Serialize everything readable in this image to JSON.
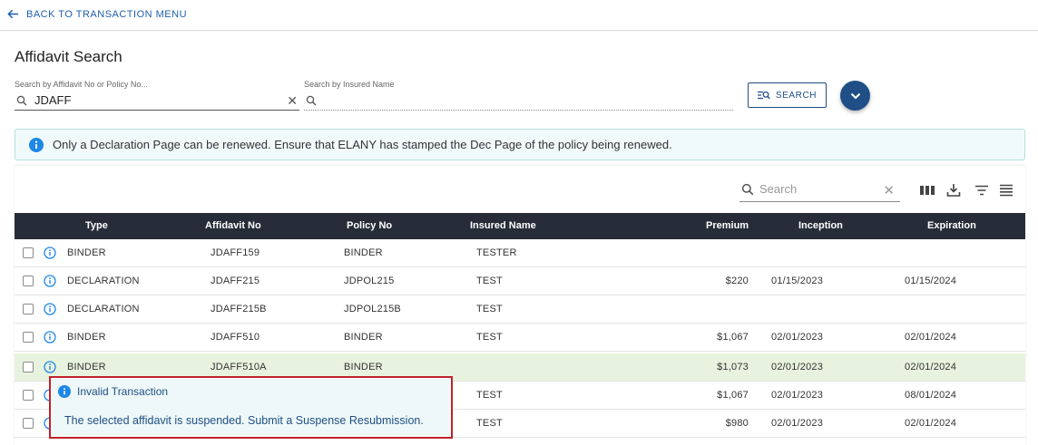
{
  "nav": {
    "back_label": "BACK TO TRANSACTION MENU"
  },
  "page": {
    "title": "Affidavit Search"
  },
  "search": {
    "affidavit_label": "Search by Affidavit No or Policy No...",
    "affidavit_value": "JDAFF",
    "insured_label": "Search by Insured Name",
    "insured_value": "",
    "search_button_label": "SEARCH"
  },
  "banner": {
    "text": "Only a Declaration Page can be renewed. Ensure that ELANY has stamped the Dec Page of the policy being renewed."
  },
  "table": {
    "search_placeholder": "Search",
    "headers": {
      "type": "Type",
      "affidavit": "Affidavit No",
      "policy": "Policy No",
      "insured": "Insured Name",
      "premium": "Premium",
      "inception": "Inception",
      "expiration": "Expiration"
    },
    "rows": [
      {
        "type": "BINDER",
        "affidavit": "JDAFF159",
        "policy": "BINDER",
        "insured": "TESTER",
        "premium": "",
        "inception": "",
        "expiration": ""
      },
      {
        "type": "DECLARATION",
        "affidavit": "JDAFF215",
        "policy": "JDPOL215",
        "insured": "TEST",
        "premium": "$220",
        "inception": "01/15/2023",
        "expiration": "01/15/2024"
      },
      {
        "type": "DECLARATION",
        "affidavit": "JDAFF215B",
        "policy": "JDPOL215B",
        "insured": "TEST",
        "premium": "",
        "inception": "",
        "expiration": ""
      },
      {
        "type": "BINDER",
        "affidavit": "JDAFF510",
        "policy": "BINDER",
        "insured": "TEST",
        "premium": "$1,067",
        "inception": "02/01/2023",
        "expiration": "02/01/2024"
      },
      {
        "type": "BINDER",
        "affidavit": "JDAFF510A",
        "policy": "BINDER",
        "insured": "",
        "premium": "$1,073",
        "inception": "02/01/2023",
        "expiration": "02/01/2024"
      },
      {
        "type": "",
        "affidavit": "",
        "policy": "",
        "insured": "TEST",
        "premium": "$1,067",
        "inception": "02/01/2023",
        "expiration": "08/01/2024"
      },
      {
        "type": "",
        "affidavit": "",
        "policy": "",
        "insured": "TEST",
        "premium": "$980",
        "inception": "02/01/2023",
        "expiration": "02/01/2024"
      }
    ]
  },
  "popup": {
    "title": "Invalid Transaction",
    "message": "The selected affidavit is suspended. Submit a Suspense Resubmission."
  },
  "colors": {
    "brand": "#1f4f86",
    "header_bg": "#262d38",
    "highlight_row": "#e8f3df",
    "alert_border": "#c0202a",
    "info_blue": "#1e88e5"
  },
  "icons": [
    "arrow-left-icon",
    "search-icon",
    "clear-icon",
    "search-list-icon",
    "chevron-down-icon",
    "info-icon",
    "columns-icon",
    "download-icon",
    "filter-icon",
    "density-icon"
  ]
}
